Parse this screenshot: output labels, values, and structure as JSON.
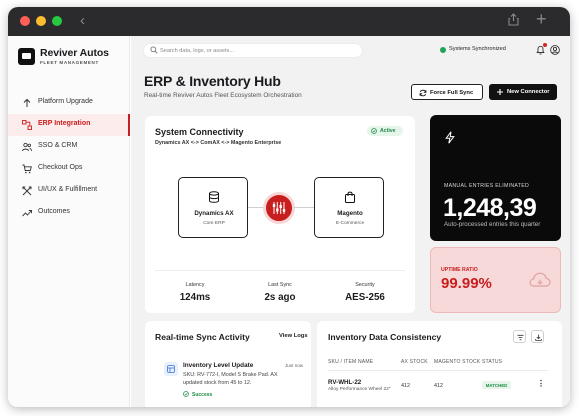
{
  "brand": {
    "name": "Reviver Autos",
    "subtitle": "FLEET MANAGEMENT"
  },
  "sidebar": {
    "items": [
      {
        "label": "Platform Upgrade",
        "icon": "arrow-up-icon",
        "active": false
      },
      {
        "label": "ERP Integration",
        "icon": "workflow-icon",
        "active": true
      },
      {
        "label": "SSO & CRM",
        "icon": "users-icon",
        "active": false
      },
      {
        "label": "Checkout Ops",
        "icon": "cart-icon",
        "active": false
      },
      {
        "label": "UI/UX & Fulfillment",
        "icon": "crossed-arrows-icon",
        "active": false
      },
      {
        "label": "Outcomes",
        "icon": "trend-icon",
        "active": false
      }
    ]
  },
  "topbar": {
    "search_placeholder": "Search data, logs, or assets...",
    "status_text": "Systems Synchronized",
    "status_color": "#22a35a"
  },
  "header": {
    "title": "ERP & Inventory Hub",
    "subtitle": "Real-time Reviver Autos Fleet Ecosystem Orchestration",
    "force_sync_label": "Force Full Sync",
    "new_connector_label": "New Connector"
  },
  "connectivity": {
    "title": "System Connectivity",
    "subtitle": "Dynamics AX <-> ComAX <-> Magento Enterprise",
    "status": "Active",
    "left_node": {
      "title": "Dynamics AX",
      "subtitle": "Core ERP",
      "icon": "database-icon"
    },
    "right_node": {
      "title": "Magento",
      "subtitle": "E-Commerce",
      "icon": "shopping-bag-icon"
    },
    "hub_icon": "sync-hub-icon",
    "stats": [
      {
        "label": "Latency",
        "value": "124ms"
      },
      {
        "label": "Last Sync",
        "value": "2s ago"
      },
      {
        "label": "Security",
        "value": "AES-256"
      }
    ]
  },
  "metric": {
    "label": "MANUAL ENTRIES ELIMINATED",
    "value": "1,248,39",
    "description": "Auto-processed entries this quarter",
    "icon": "lightning-icon"
  },
  "uptime": {
    "label": "UPTIME RATIO",
    "value": "99.99%",
    "icon": "cloud-icon"
  },
  "activity": {
    "title": "Real-time Sync Activity",
    "link": "View Logs",
    "events": [
      {
        "title": "Inventory Level Update",
        "time": "Just now",
        "description": "SKU: RV-772-I, Model S Brake Pad. AX updated stock from 45 to 12.",
        "status": "Success"
      }
    ]
  },
  "inventory": {
    "title": "Inventory Data Consistency",
    "columns": [
      "SKU / ITEM NAME",
      "AX STOCK",
      "MAGENTO STOCK",
      "STATUS"
    ],
    "rows": [
      {
        "sku": "RV-WHL-22",
        "name": "Alloy Performance Wheel 22\"",
        "ax_stock": "412",
        "magento_stock": "412",
        "status": "MATCHED"
      }
    ]
  },
  "colors": {
    "accent": "#c81e1e",
    "success": "#1e8a45",
    "dark": "#0a0a0a",
    "uptime_bg": "#f8d9d9"
  }
}
